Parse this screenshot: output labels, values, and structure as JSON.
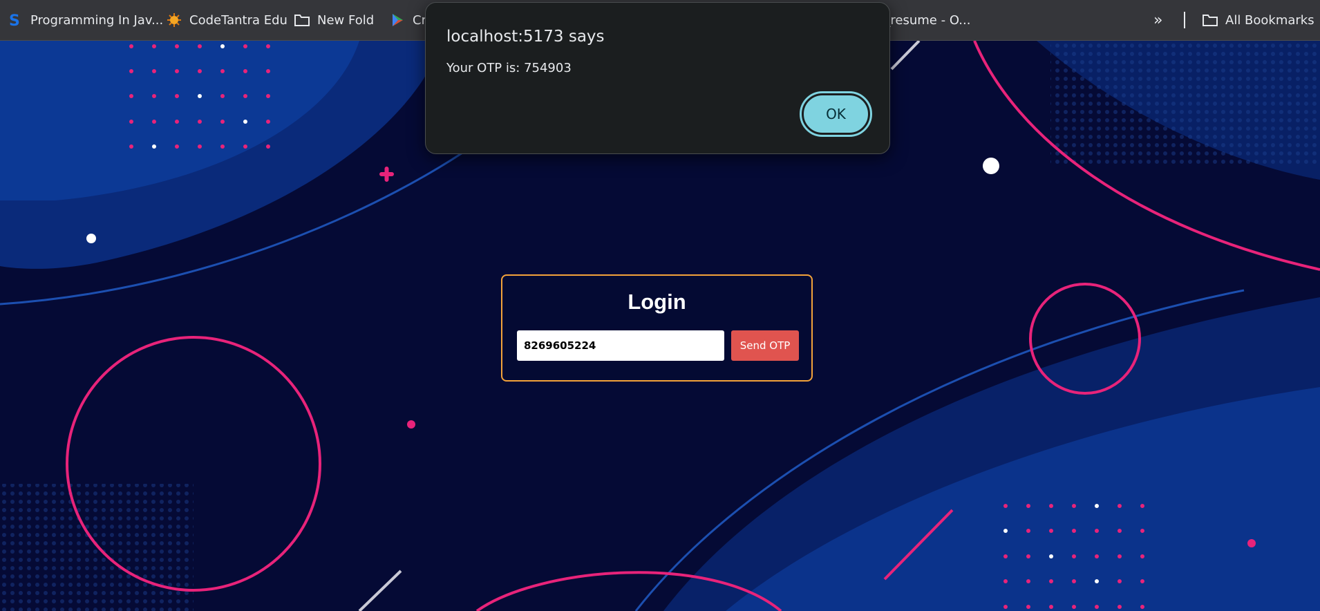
{
  "bookmarks": {
    "items": [
      {
        "label": "Programming In Jav...",
        "icon": "s-logo-icon"
      },
      {
        "label": "CodeTantra Edu",
        "icon": "gear-sun-icon"
      },
      {
        "label": "New Fold",
        "icon": "folder-icon"
      },
      {
        "label": "Cr",
        "icon": "play-icon"
      },
      {
        "label": "n_resume - O...",
        "icon": ""
      }
    ],
    "overflow_label": "»",
    "all_bookmarks_label": "All Bookmarks"
  },
  "login": {
    "title": "Login",
    "phone_value": "8269605224",
    "send_otp_label": "Send OTP"
  },
  "alert": {
    "title": "localhost:5173 says",
    "message": "Your OTP is: 754903",
    "ok_label": "OK"
  },
  "colors": {
    "background": "#050a35",
    "accent_pink": "#e8237a",
    "card_border": "#f4a33a",
    "send_button": "#e0544f",
    "ok_button": "#7fd3e0"
  }
}
